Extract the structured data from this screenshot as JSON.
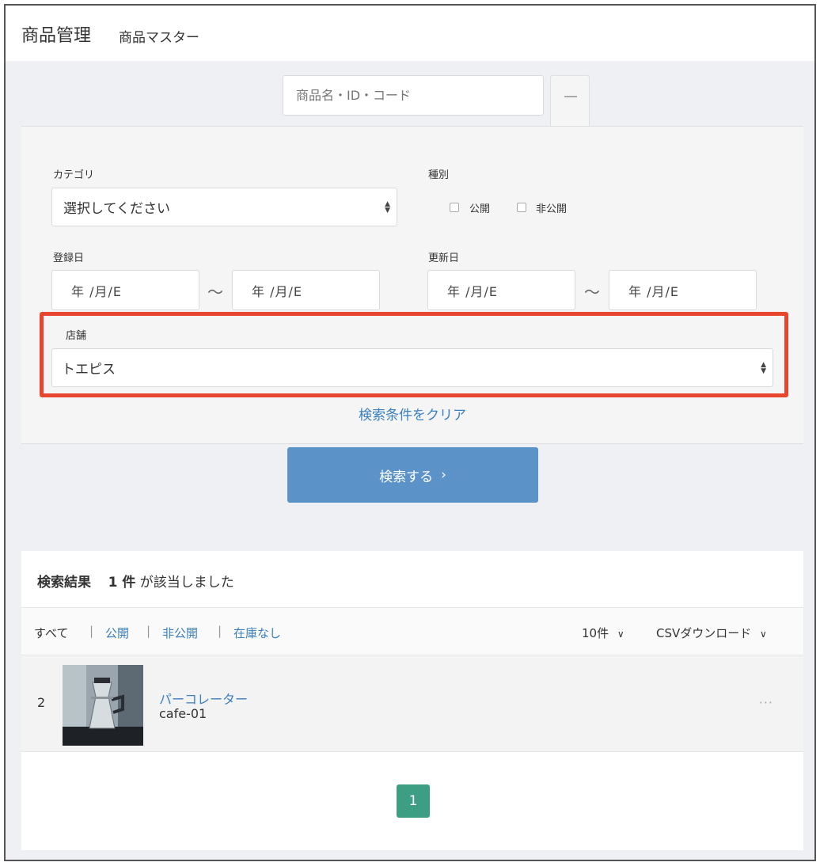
{
  "header": {
    "title": "商品管理",
    "subtitle": "商品マスター"
  },
  "search": {
    "placeholder": "商品名・ID・コード"
  },
  "form": {
    "category": {
      "label": "カテゴリ",
      "value": "選択してください"
    },
    "type": {
      "label": "種別",
      "options": [
        "公開",
        "非公開"
      ]
    },
    "registered": {
      "label": "登録日",
      "from": "年 /月/E",
      "to": "年 /月/E",
      "separator": "〜"
    },
    "updated": {
      "label": "更新日",
      "from": "年 /月/E",
      "to": "年 /月/E",
      "separator": "〜"
    },
    "store": {
      "label": "店舗",
      "value": "トエピス"
    },
    "clear_label": "検索条件をクリア"
  },
  "search_button": {
    "label": "検索する",
    "chevron": "›"
  },
  "results": {
    "heading": "検索結果",
    "count": "1 件",
    "suffix": "が該当しました",
    "filters": [
      "すべて",
      "公開",
      "非公開",
      "在庫なし"
    ],
    "per_page": "10件",
    "csv": "CSVダウンロード",
    "items": [
      {
        "number": "2",
        "name": "パーコレーター",
        "code": "cafe-01",
        "more": "···"
      }
    ]
  },
  "pagination": {
    "current": "1"
  },
  "colors": {
    "highlight": "#e8452f",
    "link": "#3a7fbf",
    "button": "#5b92c7",
    "page": "#3c9e82"
  }
}
